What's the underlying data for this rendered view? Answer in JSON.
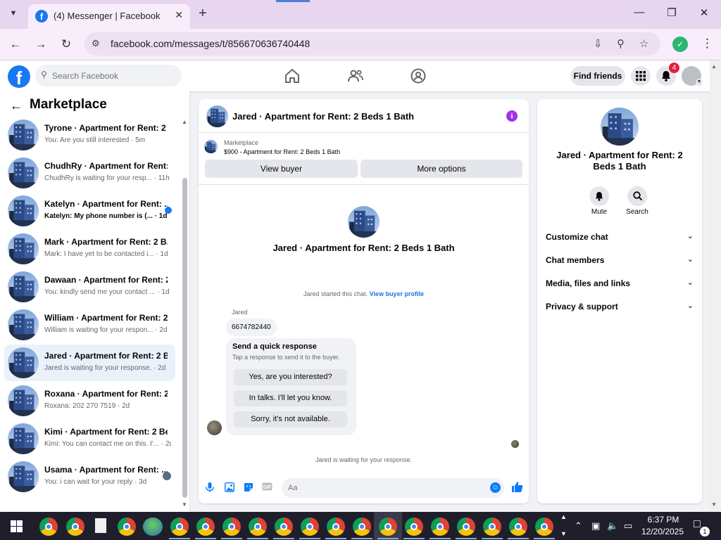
{
  "browser": {
    "tab_title": "(4) Messenger | Facebook",
    "url": "facebook.com/messages/t/856670636740448"
  },
  "header": {
    "logo_letter": "f",
    "search_placeholder": "Search Facebook",
    "find_friends_label": "Find friends",
    "notification_count": "4"
  },
  "sidebar": {
    "title": "Marketplace",
    "conversations": [
      {
        "name": "",
        "snippet": "You: Are you still interested · 5m",
        "partial": true
      },
      {
        "name": "Tyrone · Apartment for Rent: 2 ...",
        "snippet": "You: Are you still interested · 5m"
      },
      {
        "name": "ChudhRy · Apartment for Rent: ...",
        "snippet": "ChudhRy is waiting for your resp... · 11h"
      },
      {
        "name": "Katelyn · Apartment for Rent: ...",
        "snippet": "Katelyn: My phone number is (... · 1d",
        "unread": true
      },
      {
        "name": "Mark · Apartment for Rent: 2 B...",
        "snippet": "Mark: I have yet to be contacted i... · 1d"
      },
      {
        "name": "Dawaan · Apartment for Rent: 2...",
        "snippet": "You: kindly send me your contact ... · 1d"
      },
      {
        "name": "William · Apartment for Rent: 2...",
        "snippet": "William is waiting for your respon... · 2d"
      },
      {
        "name": "Jared · Apartment for Rent: 2 B...",
        "snippet": "Jared is waiting for your response. · 2d",
        "active": true
      },
      {
        "name": "Roxana · Apartment for Rent: 2 ...",
        "snippet": "Roxana: 202 270 7519 · 2d"
      },
      {
        "name": "Kimi · Apartment for Rent: 2 Be...",
        "snippet": "Kimi: You can contact me on this. I'... · 2d"
      },
      {
        "name": "Usama · Apartment for Rent: ...",
        "snippet": "You: i can wait for your reply · 3d"
      }
    ]
  },
  "chat": {
    "title": "Jared · Apartment for Rent: 2 Beds 1 Bath",
    "listing_label": "Marketplace",
    "listing_title": "$900 - Apartment for Rent: 2 Beds 1 Bath",
    "view_buyer_label": "View buyer",
    "more_options_label": "More options",
    "center_title": "Jared · Apartment for Rent: 2 Beds 1 Bath",
    "started_text": "Jared started this chat.",
    "view_profile_link": "View buyer profile",
    "sender_name": "Jared",
    "message_text": "6674782440",
    "quick_response_title": "Send a quick response",
    "quick_response_subtitle": "Tap a response to send it to the buyer.",
    "quick_responses": [
      "Yes, are you interested?",
      "In talks. I'll let you know.",
      "Sorry, it's not available."
    ],
    "waiting_text": "Jared is waiting for your response.",
    "composer_placeholder": "Aa"
  },
  "info_panel": {
    "title": "Jared · Apartment for Rent: 2 Beds 1 Bath",
    "mute_label": "Mute",
    "search_label": "Search",
    "sections": [
      "Customize chat",
      "Chat members",
      "Media, files and links",
      "Privacy & support"
    ]
  },
  "taskbar": {
    "time": "6:37 PM",
    "date": "12/20/2025",
    "notification_count": "1"
  },
  "colors": {
    "brand_blue": "#1877f2",
    "messenger_blue": "#0a7cff",
    "info_purple": "#a033e6",
    "active_conversation": "#ebf1fb"
  }
}
